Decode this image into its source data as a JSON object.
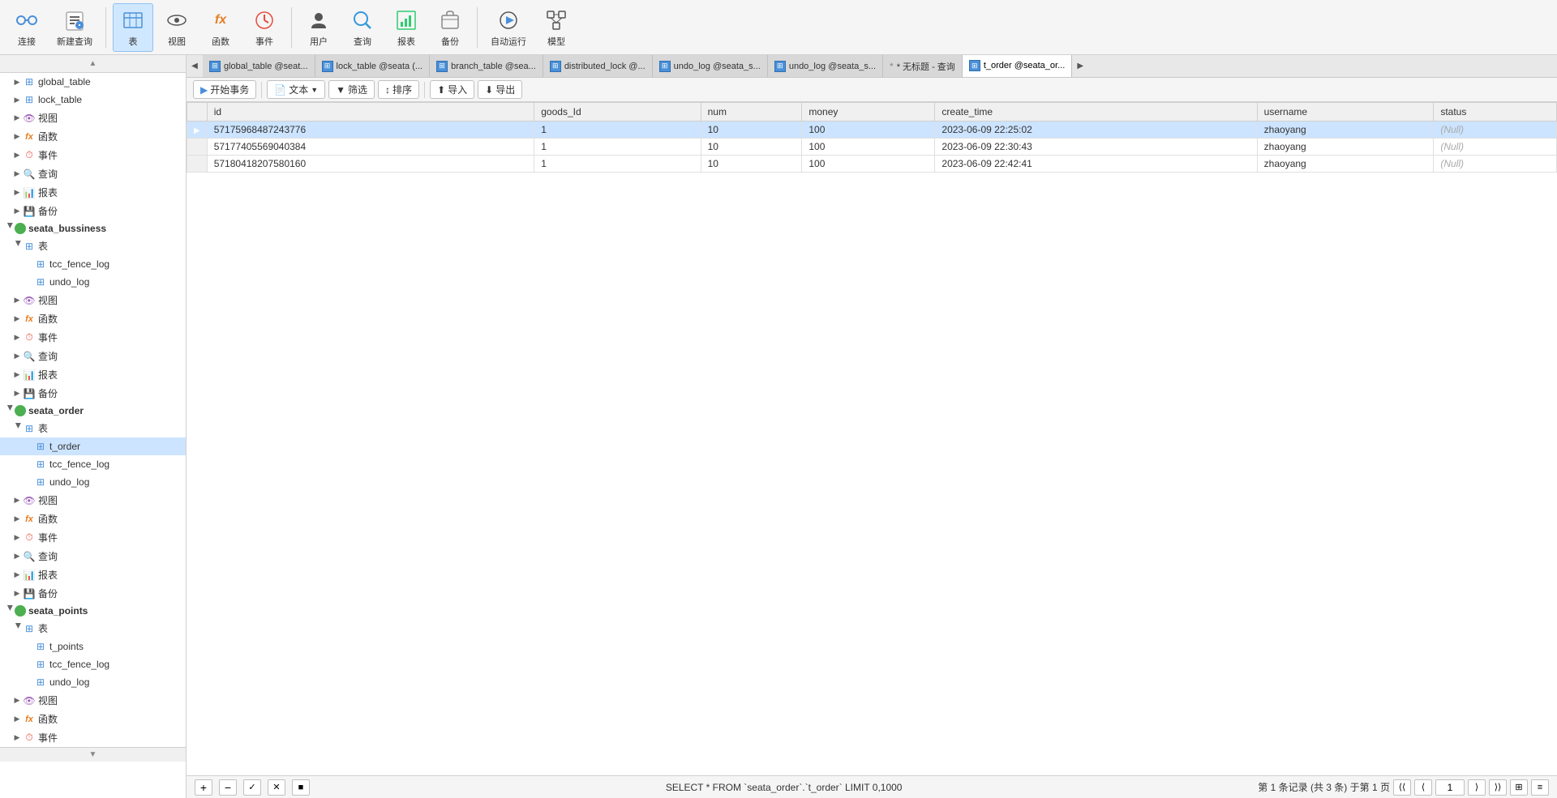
{
  "toolbar": {
    "buttons": [
      {
        "id": "connect",
        "label": "连接",
        "icon": "🔌"
      },
      {
        "id": "new-query",
        "label": "新建查询",
        "icon": "📝"
      },
      {
        "id": "table",
        "label": "表",
        "icon": "⊞",
        "active": true
      },
      {
        "id": "view",
        "label": "视图",
        "icon": "👁"
      },
      {
        "id": "function",
        "label": "函数",
        "icon": "fx"
      },
      {
        "id": "event",
        "label": "事件",
        "icon": "⏰"
      },
      {
        "id": "user",
        "label": "用户",
        "icon": "👤"
      },
      {
        "id": "query",
        "label": "查询",
        "icon": "🔍"
      },
      {
        "id": "report",
        "label": "报表",
        "icon": "📊"
      },
      {
        "id": "backup",
        "label": "备份",
        "icon": "💾"
      },
      {
        "id": "autorun",
        "label": "自动运行",
        "icon": "▶"
      },
      {
        "id": "model",
        "label": "模型",
        "icon": "🗂"
      }
    ]
  },
  "sidebar": {
    "items": [
      {
        "id": "global_table",
        "label": "global_table",
        "level": 1,
        "type": "table",
        "expanded": false
      },
      {
        "id": "lock_table",
        "label": "lock_table",
        "level": 1,
        "type": "table",
        "expanded": false
      },
      {
        "id": "view1",
        "label": "视图",
        "level": 1,
        "type": "view",
        "expanded": false
      },
      {
        "id": "func1",
        "label": "函数",
        "level": 1,
        "type": "function",
        "expanded": false
      },
      {
        "id": "event1",
        "label": "事件",
        "level": 1,
        "type": "event",
        "expanded": false
      },
      {
        "id": "query1",
        "label": "查询",
        "level": 1,
        "type": "query",
        "expanded": false
      },
      {
        "id": "report1",
        "label": "报表",
        "level": 1,
        "type": "report",
        "expanded": false
      },
      {
        "id": "backup1",
        "label": "备份",
        "level": 1,
        "type": "backup",
        "expanded": false
      },
      {
        "id": "seata_bussiness",
        "label": "seata_bussiness",
        "level": 0,
        "type": "db",
        "expanded": true
      },
      {
        "id": "table_group_bus",
        "label": "表",
        "level": 1,
        "type": "table-group",
        "expanded": true
      },
      {
        "id": "tcc_fence_log",
        "label": "tcc_fence_log",
        "level": 2,
        "type": "table"
      },
      {
        "id": "undo_log_bus",
        "label": "undo_log",
        "level": 2,
        "type": "table"
      },
      {
        "id": "view_bus",
        "label": "视图",
        "level": 1,
        "type": "view"
      },
      {
        "id": "func_bus",
        "label": "函数",
        "level": 1,
        "type": "function"
      },
      {
        "id": "event_bus",
        "label": "事件",
        "level": 1,
        "type": "event"
      },
      {
        "id": "query_bus",
        "label": "查询",
        "level": 1,
        "type": "query"
      },
      {
        "id": "report_bus",
        "label": "报表",
        "level": 1,
        "type": "report"
      },
      {
        "id": "backup_bus",
        "label": "备份",
        "level": 1,
        "type": "backup"
      },
      {
        "id": "seata_order",
        "label": "seata_order",
        "level": 0,
        "type": "db",
        "expanded": true
      },
      {
        "id": "table_group_ord",
        "label": "表",
        "level": 1,
        "type": "table-group",
        "expanded": true
      },
      {
        "id": "t_order",
        "label": "t_order",
        "level": 2,
        "type": "table",
        "selected": true
      },
      {
        "id": "tcc_fence_log_ord",
        "label": "tcc_fence_log",
        "level": 2,
        "type": "table"
      },
      {
        "id": "undo_log_ord",
        "label": "undo_log",
        "level": 2,
        "type": "table"
      },
      {
        "id": "view_ord",
        "label": "视图",
        "level": 1,
        "type": "view"
      },
      {
        "id": "func_ord",
        "label": "函数",
        "level": 1,
        "type": "function"
      },
      {
        "id": "event_ord",
        "label": "事件",
        "level": 1,
        "type": "event"
      },
      {
        "id": "query_ord",
        "label": "查询",
        "level": 1,
        "type": "query"
      },
      {
        "id": "report_ord",
        "label": "报表",
        "level": 1,
        "type": "report"
      },
      {
        "id": "backup_ord",
        "label": "备份",
        "level": 1,
        "type": "backup"
      },
      {
        "id": "seata_points",
        "label": "seata_points",
        "level": 0,
        "type": "db",
        "expanded": true
      },
      {
        "id": "table_group_pts",
        "label": "表",
        "level": 1,
        "type": "table-group",
        "expanded": true
      },
      {
        "id": "t_points",
        "label": "t_points",
        "level": 2,
        "type": "table"
      },
      {
        "id": "tcc_fence_log_pts",
        "label": "tcc_fence_log",
        "level": 2,
        "type": "table"
      },
      {
        "id": "undo_log_pts",
        "label": "undo_log",
        "level": 2,
        "type": "table"
      },
      {
        "id": "view_pts",
        "label": "视图",
        "level": 1,
        "type": "view"
      },
      {
        "id": "func_pts",
        "label": "函数",
        "level": 1,
        "type": "function"
      },
      {
        "id": "event_pts",
        "label": "事件",
        "level": 1,
        "type": "event"
      }
    ]
  },
  "tabs": [
    {
      "id": "global_table",
      "label": "global_table @seat...",
      "type": "table",
      "active": false
    },
    {
      "id": "lock_table",
      "label": "lock_table @seata (...",
      "type": "table",
      "active": false
    },
    {
      "id": "branch_table",
      "label": "branch_table @sea...",
      "type": "table",
      "active": false
    },
    {
      "id": "distributed_lock",
      "label": "distributed_lock @...",
      "type": "table",
      "active": false
    },
    {
      "id": "undo_log",
      "label": "undo_log @seata_s...",
      "type": "table",
      "active": false
    },
    {
      "id": "undo_log2",
      "label": "undo_log @seata_s...",
      "type": "table",
      "active": false
    },
    {
      "id": "no_title",
      "label": "* 无标题 - 查询",
      "type": "query",
      "active": false
    },
    {
      "id": "t_order",
      "label": "t_order @seata_or...",
      "type": "table",
      "active": true
    }
  ],
  "actions": {
    "start": "开始事务",
    "text": "文本",
    "filter": "筛选",
    "sort": "排序",
    "import": "导入",
    "export": "导出"
  },
  "table": {
    "columns": [
      "id",
      "goods_Id",
      "num",
      "money",
      "create_time",
      "username",
      "status"
    ],
    "rows": [
      {
        "id": "57175968487243776",
        "goods_Id": "1",
        "num": "10",
        "money": "100",
        "create_time": "2023-06-09 22:25:02",
        "username": "zhaoyang",
        "status": "(Null)",
        "selected": true
      },
      {
        "id": "57177405569040384",
        "goods_Id": "1",
        "num": "10",
        "money": "100",
        "create_time": "2023-06-09 22:30:43",
        "username": "zhaoyang",
        "status": "(Null)"
      },
      {
        "id": "57180418207580160",
        "goods_Id": "1",
        "num": "10",
        "money": "100",
        "create_time": "2023-06-09 22:42:41",
        "username": "zhaoyang",
        "status": "(Null)"
      }
    ]
  },
  "statusbar": {
    "sql": "SELECT * FROM `seata_order`.`t_order` LIMIT 0,1000",
    "record_info": "第 1 条记录 (共 3 条) 于第 1 页",
    "page": "1"
  },
  "table_bottom_controls": {
    "add": "+",
    "remove": "−",
    "confirm": "✓",
    "cancel": "✕",
    "stop": "■"
  }
}
